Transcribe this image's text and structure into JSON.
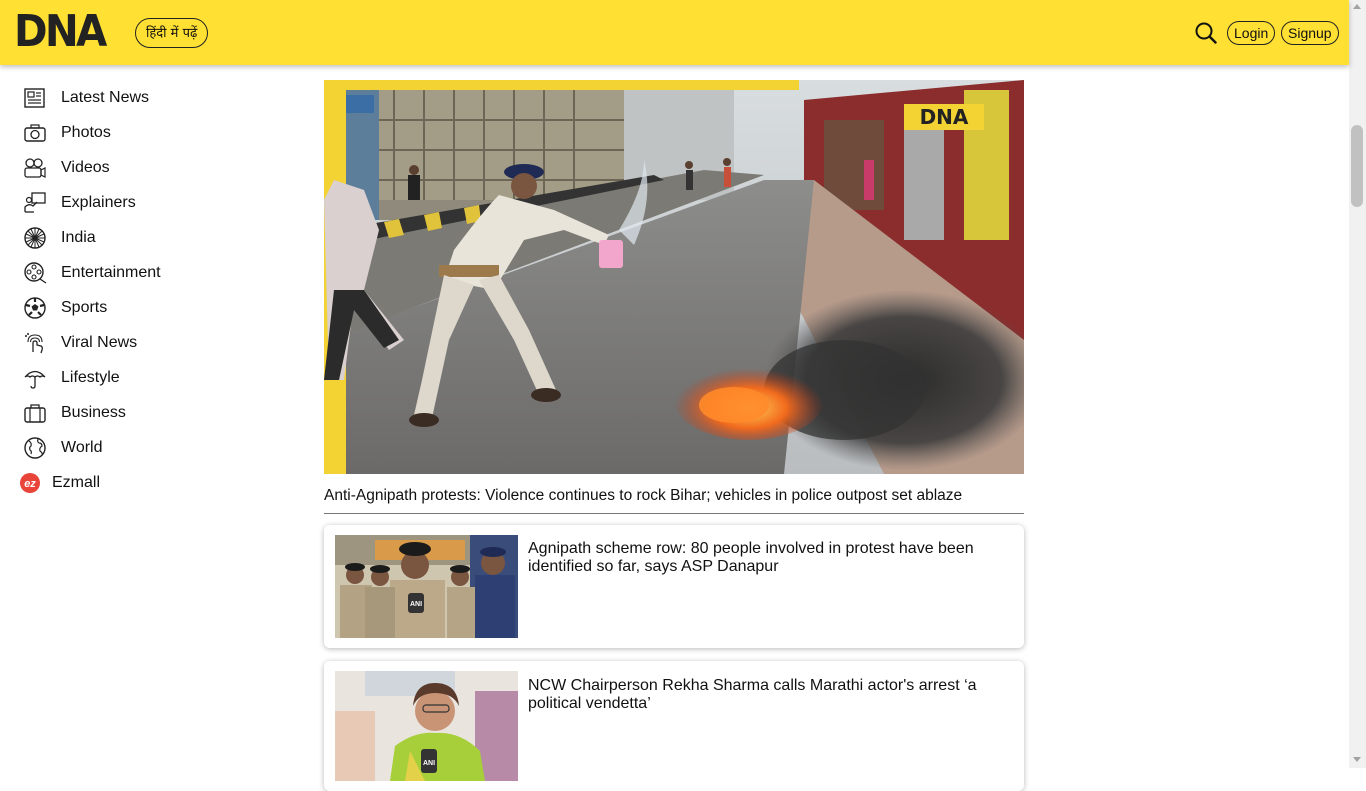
{
  "header": {
    "logo": "DNA",
    "hindi_button": "हिंदी में पढ़ें",
    "login": "Login",
    "signup": "Signup",
    "brand_color": "#ffe033"
  },
  "sidebar": {
    "items": [
      {
        "label": "Latest News",
        "icon": "newspaper-icon"
      },
      {
        "label": "Photos",
        "icon": "camera-icon"
      },
      {
        "label": "Videos",
        "icon": "video-camera-icon"
      },
      {
        "label": "Explainers",
        "icon": "presenter-icon"
      },
      {
        "label": "India",
        "icon": "ashoka-chakra-icon"
      },
      {
        "label": "Entertainment",
        "icon": "film-reel-icon"
      },
      {
        "label": "Sports",
        "icon": "football-icon"
      },
      {
        "label": "Viral News",
        "icon": "viral-touch-icon"
      },
      {
        "label": "Lifestyle",
        "icon": "umbrella-icon"
      },
      {
        "label": "Business",
        "icon": "briefcase-icon"
      },
      {
        "label": "World",
        "icon": "globe-icon"
      },
      {
        "label": "Ezmall",
        "icon": "ezmall-logo-icon",
        "badge": "ez"
      }
    ]
  },
  "hero": {
    "watermark": "DNA",
    "title": "Anti-Agnipath protests: Violence continues to rock Bihar; vehicles in police outpost set ablaze"
  },
  "stories": [
    {
      "title": "Agnipath scheme row: 80 people involved in protest have been identified so far, says ASP Danapur"
    },
    {
      "title": "NCW Chairperson Rekha Sharma calls Marathi actor's arrest ‘a political vendetta’"
    }
  ]
}
